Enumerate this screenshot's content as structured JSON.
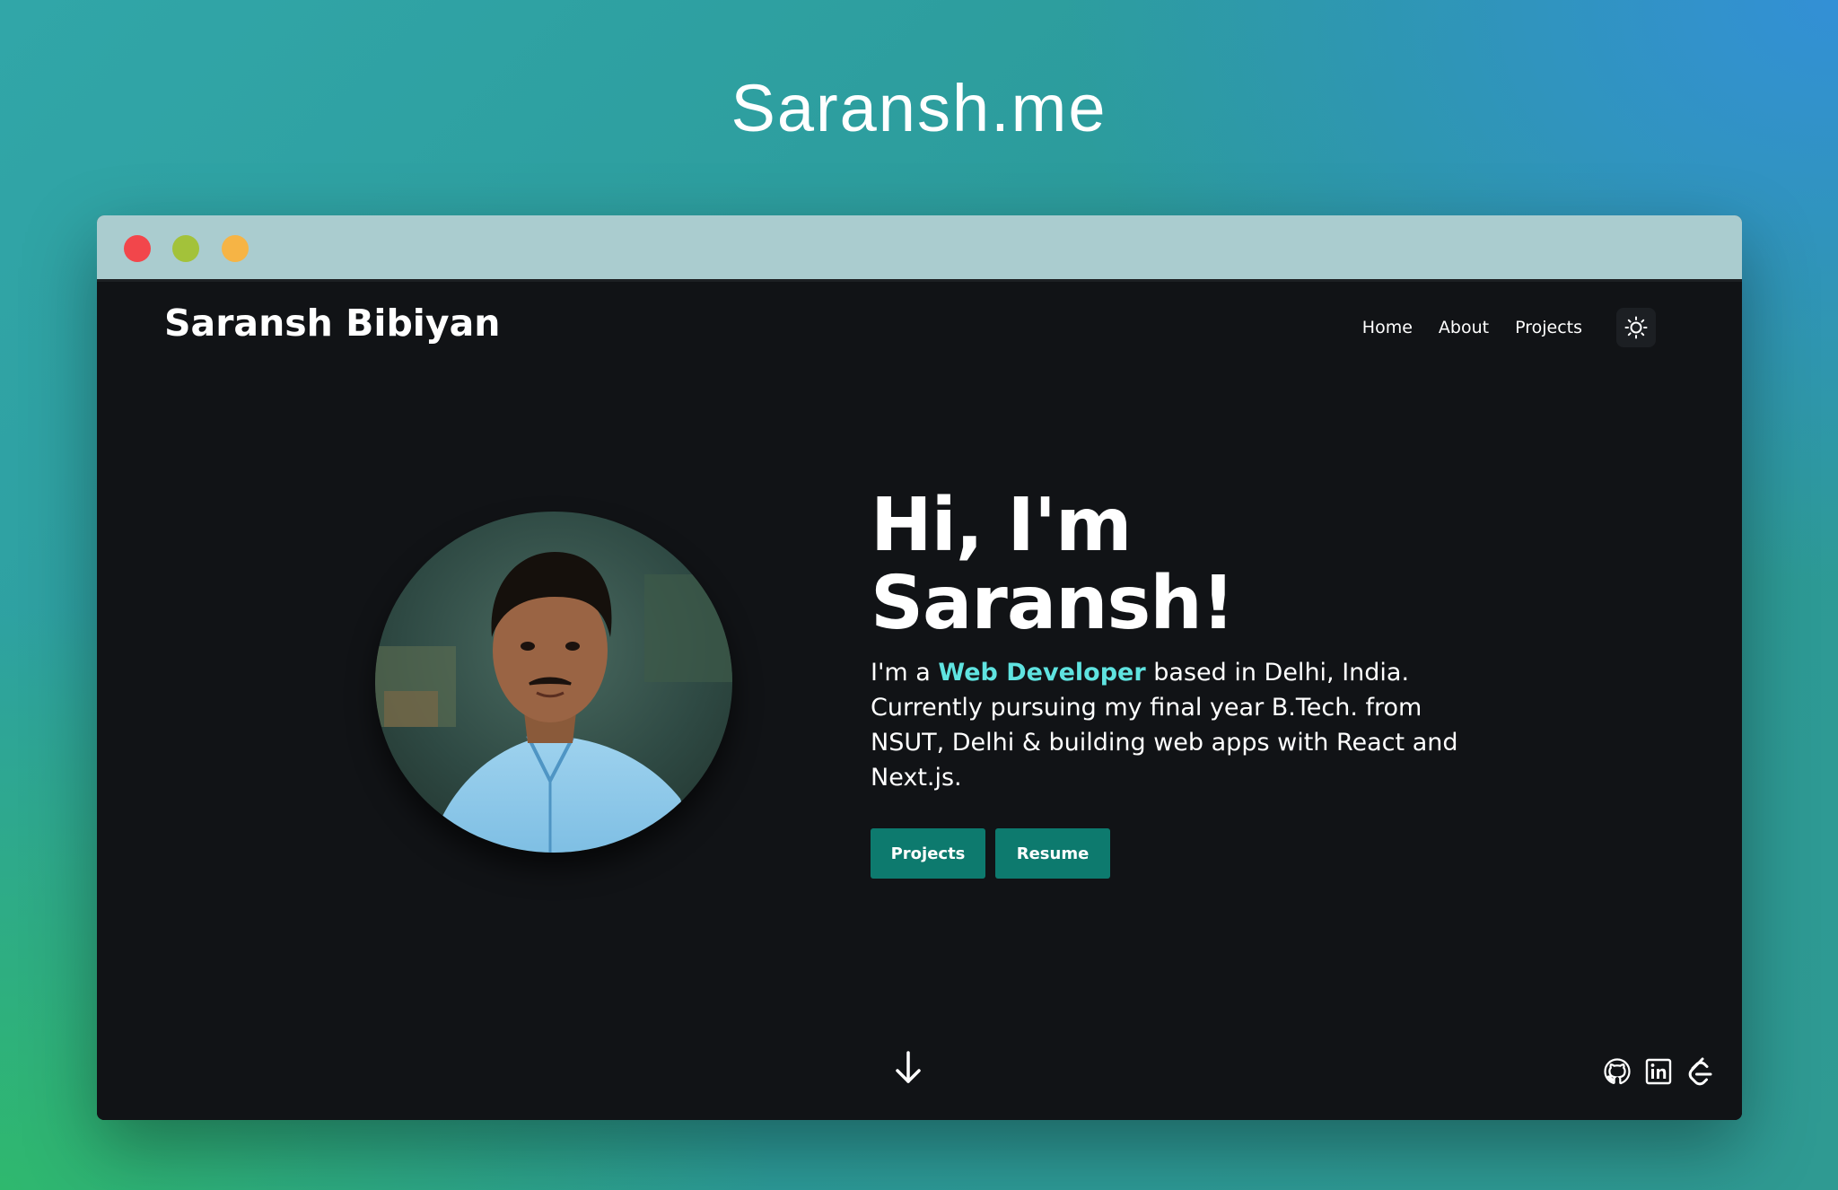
{
  "frame": {
    "title": "Saransh.me"
  },
  "window": {
    "controls": {
      "close": "red-dot",
      "minimize": "green-dot",
      "maximize": "yellow-dot"
    }
  },
  "site": {
    "brand": "Saransh Bibiyan",
    "nav": {
      "home": "Home",
      "about": "About",
      "projects": "Projects"
    },
    "theme_toggle_icon": "sun-icon",
    "hero": {
      "title_line1": "Hi, I'm",
      "title_line2": "Saransh!",
      "desc_prefix": "I'm a ",
      "desc_accent": "Web Developer",
      "desc_rest": " based in Delhi, India. Currently pursuing my final year B.Tech. from NSUT, Delhi & building web apps with React and Next.js.",
      "buttons": {
        "projects": "Projects",
        "resume": "Resume"
      }
    },
    "scroll_icon": "arrow-down-icon",
    "socials": [
      "github-icon",
      "linkedin-icon",
      "leetcode-icon"
    ]
  },
  "colors": {
    "accent": "#5fe3e0",
    "button": "#0d7a6e",
    "background": "#111316",
    "titlebar": "#aacccf"
  }
}
